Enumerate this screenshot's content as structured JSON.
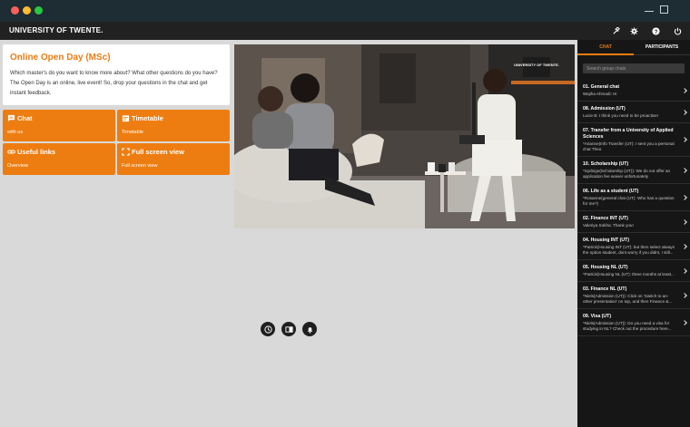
{
  "window": {
    "brand": "UNIVERSITY OF TWENTE."
  },
  "info_card": {
    "title": "Online Open Day (MSc)",
    "description": "Which master's do you want to know more about? What other questions do you have? The Open Day is an online, live event! So, drop your questions in the chat and get instant feedback."
  },
  "tiles": [
    {
      "title": "Chat",
      "subtitle": "with us",
      "icon": "chat-icon"
    },
    {
      "title": "Timetable",
      "subtitle": "Timetable",
      "icon": "calendar-icon"
    },
    {
      "title": "Useful links",
      "subtitle": "Overview",
      "icon": "link-icon"
    },
    {
      "title": "Full screen view",
      "subtitle": "Full screen view",
      "icon": "fullscreen-icon"
    }
  ],
  "video": {
    "studio_logo": "UNIVERSITY OF TWENTE."
  },
  "header_icons": [
    "hammer-icon",
    "gear-icon",
    "help-icon",
    "power-icon"
  ],
  "controls": [
    "clock-icon",
    "video-layout-icon",
    "bell-icon"
  ],
  "panel": {
    "tabs": [
      "CHAT",
      "PARTICIPANTS"
    ],
    "search_placeholder": "Search group chats",
    "groups": [
      {
        "title": "01. General chat",
        "message": "Wajiha Ahmadi: Hi"
      },
      {
        "title": "08. Admission (UT)",
        "message": "Lucie B: I think you need to be proactive!"
      },
      {
        "title": "07. Transfer from a University of Applied Sciences",
        "message": "*Arianne(Info Transfer (UT): I sent you a personal chat Theo"
      },
      {
        "title": "10. Scholarship (UT)",
        "message": "*Sydnige(Scholarship (UT)): We do not offer an application fee waiver unfortunately"
      },
      {
        "title": "06. Life as a student (UT)",
        "message": "*Rosanne(general chat (UT): Who has a question for me?)"
      },
      {
        "title": "02. Finance INT (UT)",
        "message": "Valeriya Sokha: Thank you!"
      },
      {
        "title": "04. Housing INT (UT)",
        "message": "*Patrick(Housing INT (UT): but then select always the option student, dont worry if you didnt, I still..."
      },
      {
        "title": "05. Housing NL (UT)",
        "message": "*Patrick(Housing NL (UT): three months at least..."
      },
      {
        "title": "03. Finance NL (UT)",
        "message": "*Niels(Admission (UT)): Click on 'Switch to an-other presentation' on top, and then Finance &..."
      },
      {
        "title": "09. Visa (UT)",
        "message": "*Niels(Admission (UT)): Do you need a visa for studying in NL? Check out the procedure here..."
      }
    ]
  }
}
